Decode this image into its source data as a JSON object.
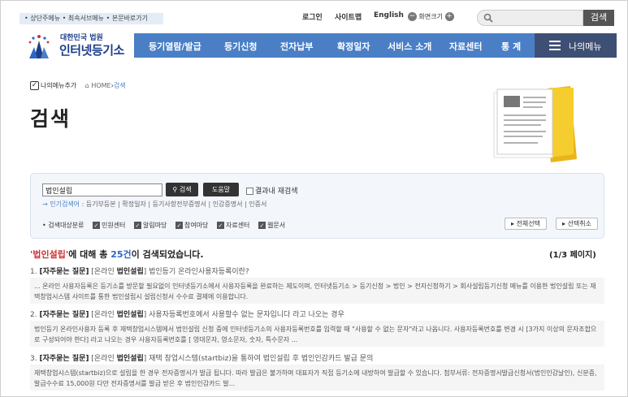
{
  "topbar": {
    "skip_links": "• 상단주메뉴 • 최속서브메뉴 • 본문바로가기",
    "login": "로그인",
    "sitemap": "사이트맵",
    "english": "English",
    "zoom_label": "화면크기",
    "search_button": "검색"
  },
  "logo": {
    "small": "대한민국 법원",
    "big": "인터넷등기소"
  },
  "gnb": {
    "items": [
      "등기열람/발급",
      "등기신청",
      "전자납부",
      "확정일자",
      "서비스 소개",
      "자료센터",
      "통 계"
    ],
    "my_menu": "나의메뉴"
  },
  "breadcrumb": {
    "add_menu": "나의메뉴추가",
    "home": "HOME",
    "current": "검색"
  },
  "page_title": "검색",
  "search_box": {
    "query": "법인설립",
    "search_btn": "검색",
    "help_btn": "도움말",
    "within_results": "결과내 재검색",
    "popular_label": "→ 인기검색어",
    "popular_terms": [
      "등기부등본",
      "확정일자",
      "등기사항전부증명서",
      "인감증명서",
      "인증서"
    ],
    "scope_label": "• 검색대상분류",
    "scopes": [
      "민원센터",
      "알림마당",
      "참여마당",
      "자료센터",
      "웹문서"
    ],
    "select_all": "전체선택",
    "deselect_all": "선택취소"
  },
  "summary": {
    "quote_open": "'",
    "query": "법인설립",
    "quote_close": "'",
    "mid": "에 대해 총 ",
    "count": "25건",
    "tail": "이 검색되었습니다.",
    "page": "(1/3 페이지)"
  },
  "results": [
    {
      "num": "1.",
      "tag": "[자주묻는 질문]",
      "cat_pre": "[온라인 ",
      "cat_bold": "법인설립",
      "cat_post": "]",
      "title": "법인등기 온라인사용자등록이란?",
      "body": "... 온라인 사용자등록은 등기소를 방문할 필요없이 인터넷등기소에서 사용자등록을 완료하는 제도이며, 인터넷등기소 > 등기신청 > 법인 > 전자신청하기 > 회사설립등기신청 메뉴를 이용한 법인설립 또는 재택창업시스템 사이트를 통한 법인설립시 설립신청서 수수료 결제에 이용합니다."
    },
    {
      "num": "2.",
      "tag": "[자주묻는 질문]",
      "cat_pre": "[온라인 ",
      "cat_bold": "법인설립",
      "cat_post": "]",
      "title": "사용자등록번호에서 사용할수 없는 문자입니다 라고 나오는 경우",
      "body": "법인등기 온라인사용자 등록 후 재택창업시스템에서 법인설립 신청 중에 인터넷등기소의 사용자등록번호를 입력할 때 \"사용할 수 없는 문자\"라고 나옵니다. 사용자등록번호를 변경 시 [3가지 이상의 문자조합으로 구성되어야 한다] 라고 나오는 경우 사용자등록번호를 [ 영대문자, 영소문자, 숫자, 특수문자 ..."
    },
    {
      "num": "3.",
      "tag": "[자주묻는 질문]",
      "cat_pre": "[온라인 ",
      "cat_bold": "법인설립",
      "cat_post": "]",
      "title": "재택 창업시스템(startbiz)을 통하여 법인설립 후 법인인감카드 발급 문의",
      "body": "재택창업시스템(startbiz)으로 설립을 한 경우 전자증명서가 발급 됩니다. 따라 발급은 불가하며 대표자가 직접 등기소에 내방하여 발급할 수 있습니다. 첨부서류: 전자증명서발급신청서(법인인감날인), 신분증, 발급수수료 15,000원 다만 전자증명서를 발급 받은 후 법인인감카드 발..."
    }
  ]
}
